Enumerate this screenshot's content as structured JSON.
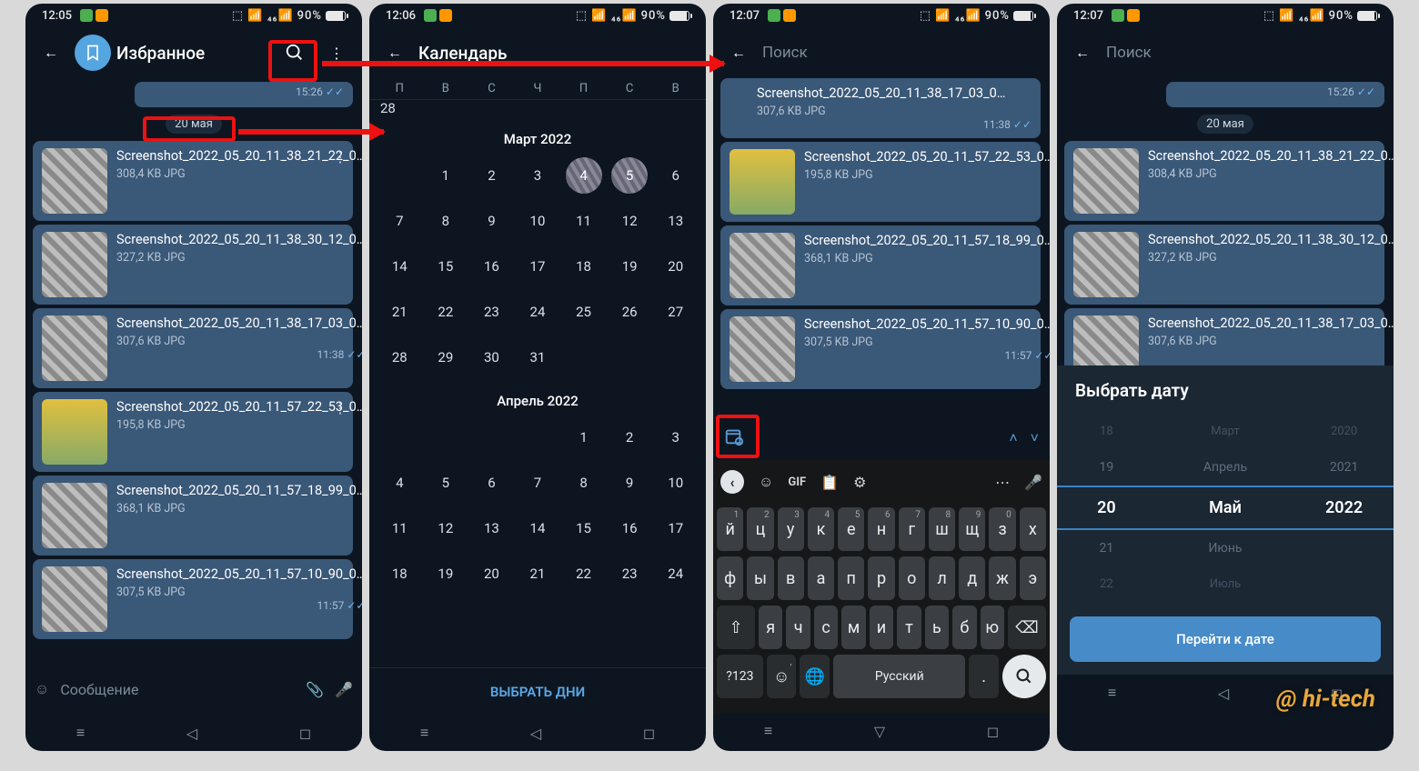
{
  "status": {
    "times": [
      "12:05",
      "12:06",
      "12:07",
      "12:07"
    ],
    "battery": "90%"
  },
  "s1": {
    "title": "Избранное",
    "date_chip": "20 мая",
    "msg_time_top": "15:26",
    "input_placeholder": "Сообщение",
    "files": [
      {
        "name": "Screenshot_2022_05_20_11_38_21_22_0…",
        "meta": "308,4 KB JPG"
      },
      {
        "name": "Screenshot_2022_05_20_11_38_30_12_0…",
        "meta": "327,2 KB JPG"
      },
      {
        "name": "Screenshot_2022_05_20_11_38_17_03_0…",
        "meta": "307,6 KB JPG",
        "time": "11:38"
      },
      {
        "name": "Screenshot_2022_05_20_11_57_22_53_0…",
        "meta": "195,8 KB JPG"
      },
      {
        "name": "Screenshot_2022_05_20_11_57_18_99_0…",
        "meta": "368,1 KB JPG"
      },
      {
        "name": "Screenshot_2022_05_20_11_57_10_90_0…",
        "meta": "307,5 KB JPG",
        "time": "11:57"
      }
    ]
  },
  "s2": {
    "title": "Календарь",
    "dow": [
      "П",
      "В",
      "С",
      "Ч",
      "П",
      "С",
      "В"
    ],
    "month1": "Март 2022",
    "month2": "Апрель 2022",
    "select_days": "ВЫБРАТЬ ДНИ"
  },
  "s3": {
    "search_placeholder": "Поиск",
    "files": [
      {
        "name": "Screenshot_2022_05_20_11_38_17_03_0…",
        "meta": "307,6 KB JPG",
        "time": "11:38"
      },
      {
        "name": "Screenshot_2022_05_20_11_57_22_53_0…",
        "meta": "195,8 KB JPG"
      },
      {
        "name": "Screenshot_2022_05_20_11_57_18_99_0…",
        "meta": "368,1 KB JPG"
      },
      {
        "name": "Screenshot_2022_05_20_11_57_10_90_0…",
        "meta": "307,5 KB JPG",
        "time": "11:57"
      }
    ],
    "kbd": {
      "top": [
        "GIF"
      ],
      "r1": [
        "й",
        "ц",
        "у",
        "к",
        "е",
        "н",
        "г",
        "ш",
        "щ",
        "з",
        "х"
      ],
      "r1s": [
        "1",
        "2",
        "3",
        "4",
        "5",
        "6",
        "7",
        "8",
        "9",
        "0",
        ""
      ],
      "r2": [
        "ф",
        "ы",
        "в",
        "а",
        "п",
        "р",
        "о",
        "л",
        "д",
        "ж",
        "э"
      ],
      "r3": [
        "я",
        "ч",
        "с",
        "м",
        "и",
        "т",
        "ь",
        "б",
        "ю"
      ],
      "sym": "?123",
      "space": "Русский"
    }
  },
  "s4": {
    "search_placeholder": "Поиск",
    "date_chip": "20 мая",
    "msg_time_top": "15:26",
    "picker_title": "Выбрать дату",
    "files": [
      {
        "name": "Screenshot_2022_05_20_11_38_21_22_0…",
        "meta": "308,4 KB JPG"
      },
      {
        "name": "Screenshot_2022_05_20_11_38_30_12_0…",
        "meta": "327,2 KB JPG"
      },
      {
        "name": "Screenshot_2022_05_20_11_38_17_03_0…",
        "meta": "307,6 KB JPG"
      }
    ],
    "wheel": {
      "days": [
        "18",
        "19",
        "20",
        "21",
        "22"
      ],
      "months": [
        "Март",
        "Апрель",
        "Май",
        "Июнь",
        "Июль"
      ],
      "years": [
        "2020",
        "2021",
        "2022",
        "",
        ""
      ]
    },
    "go": "Перейти к дате"
  },
  "watermark": "@ hi-tech"
}
